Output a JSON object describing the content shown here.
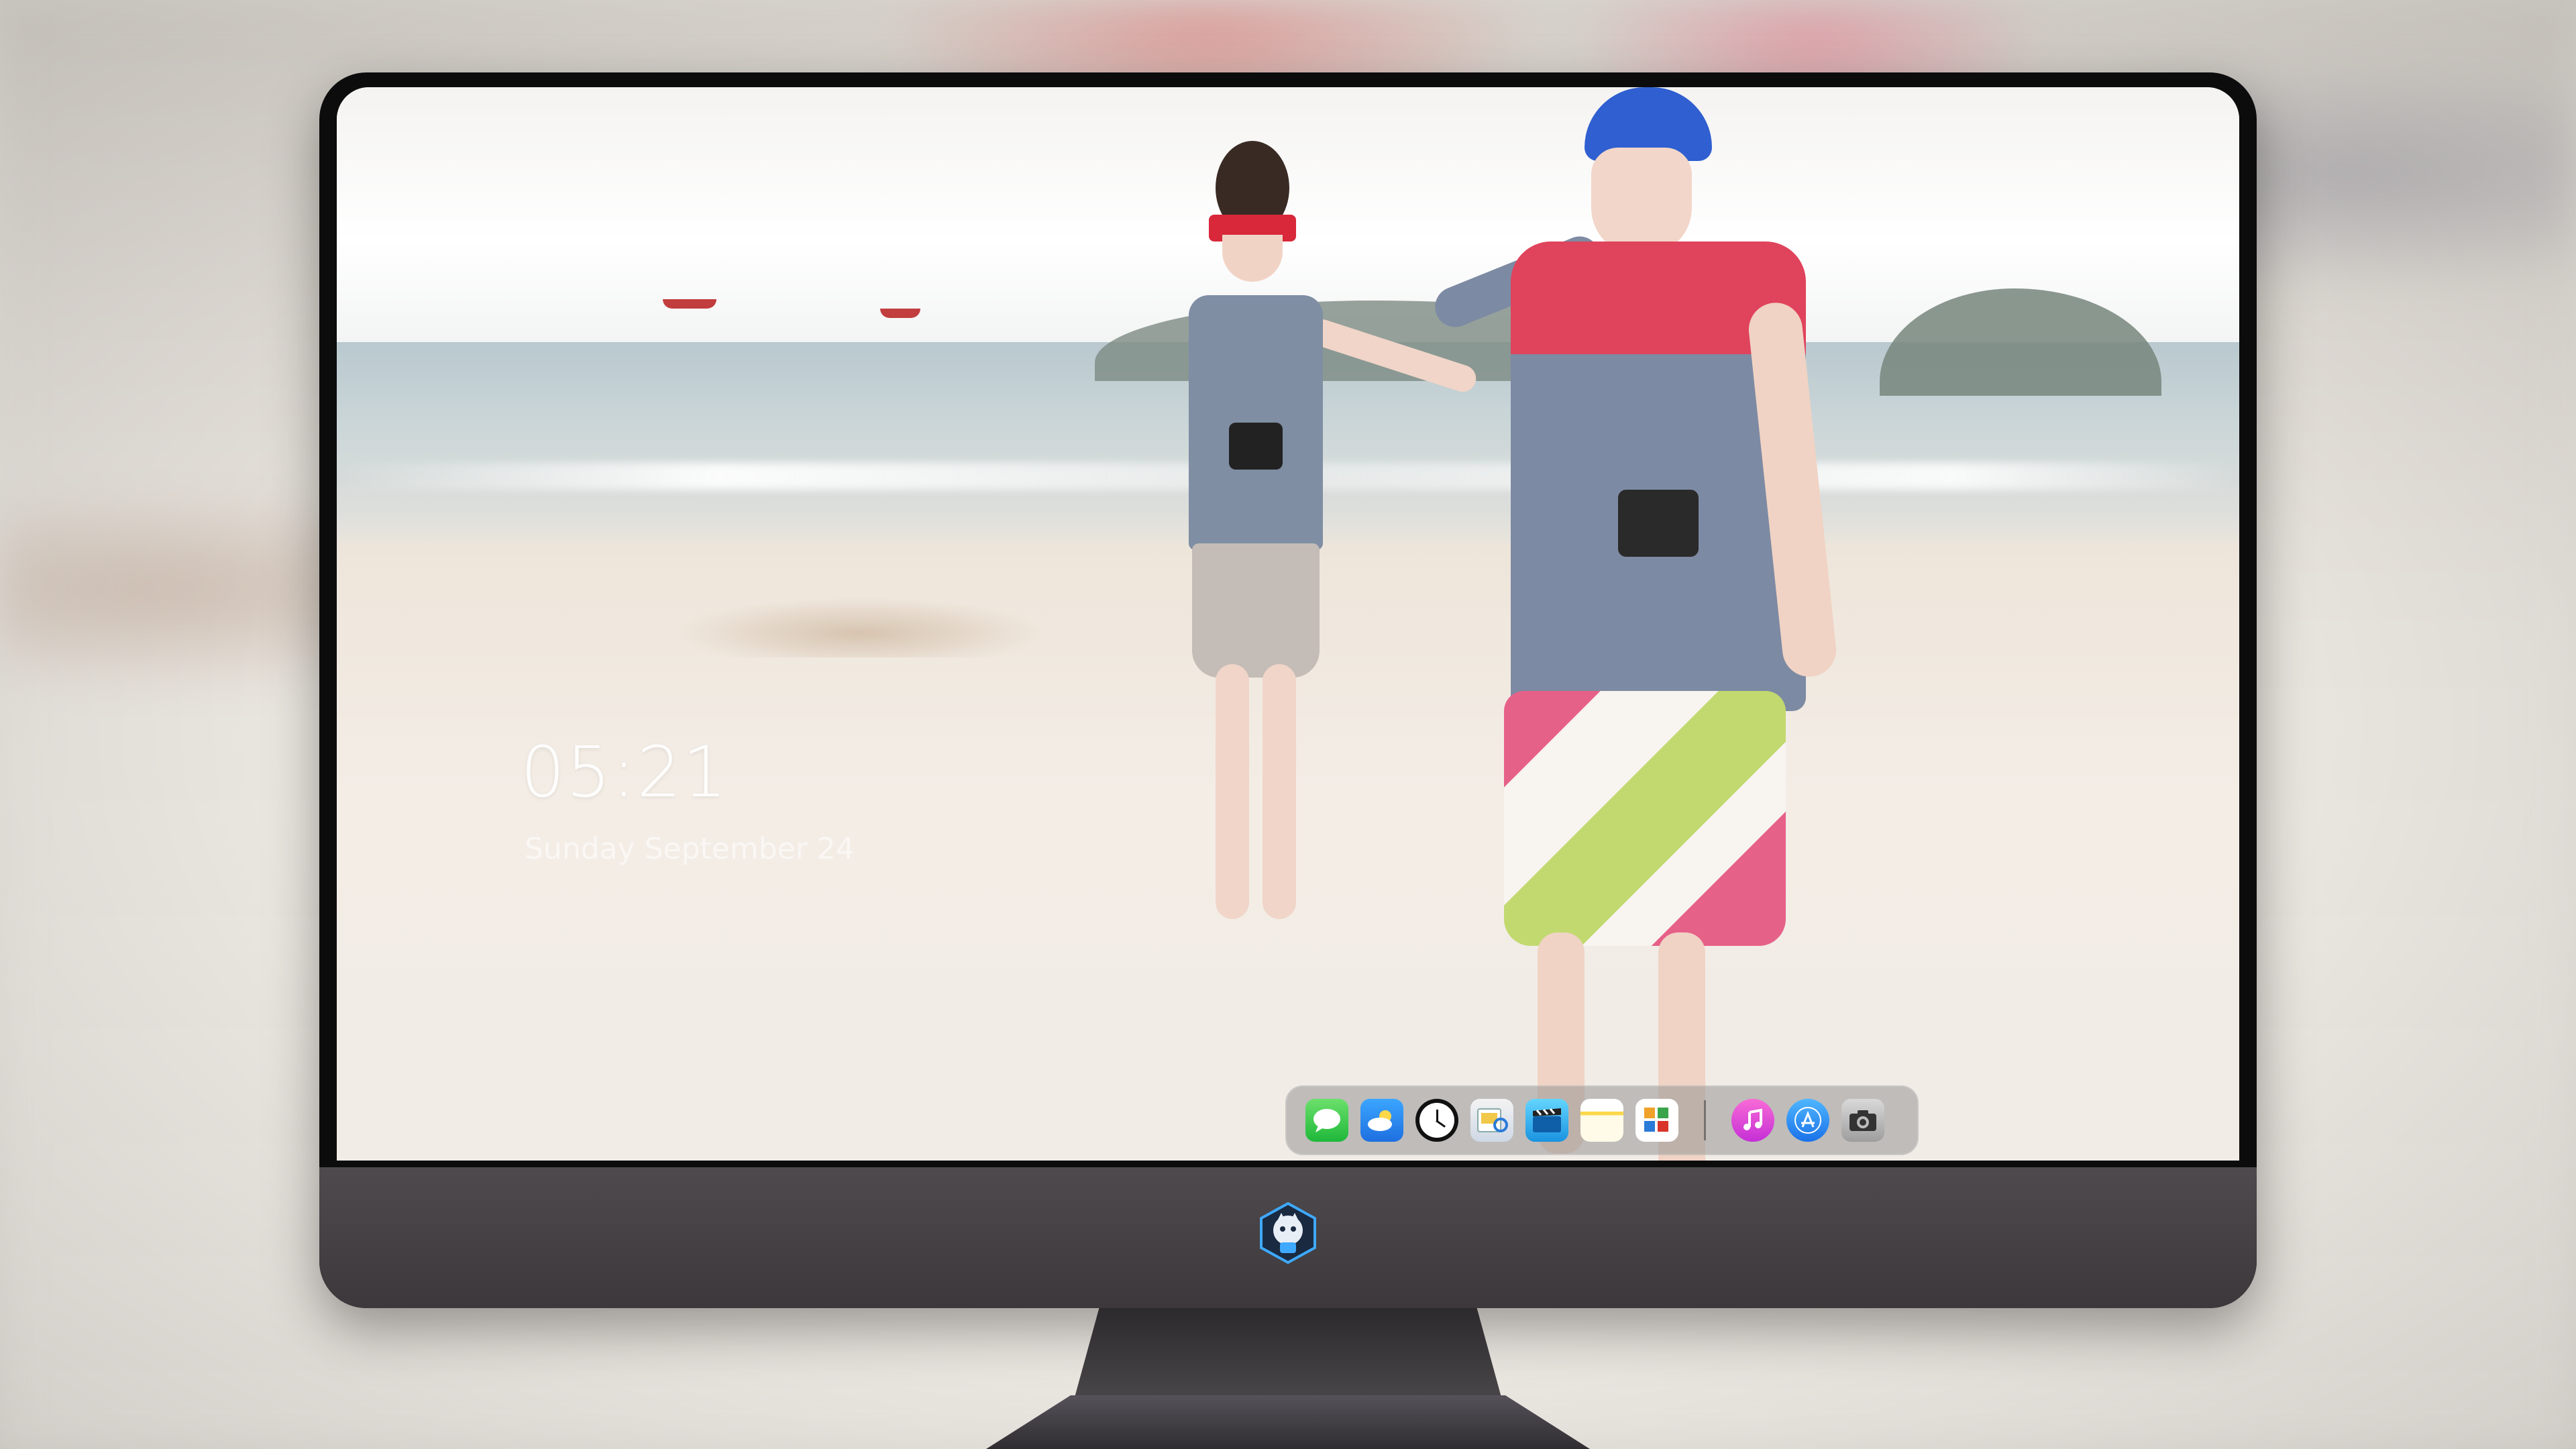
{
  "lock_screen": {
    "time": "05:21",
    "date": "Sunday September 24"
  },
  "dock": {
    "apps": [
      {
        "name": "Messages",
        "icon": "messages-icon"
      },
      {
        "name": "Weather",
        "icon": "weather-icon"
      },
      {
        "name": "Clock",
        "icon": "clock-icon"
      },
      {
        "name": "Preview",
        "icon": "preview-icon"
      },
      {
        "name": "Videos",
        "icon": "video-icon"
      },
      {
        "name": "Notes",
        "icon": "notes-icon"
      },
      {
        "name": "Photos",
        "icon": "photos-icon"
      },
      {
        "name": "Music",
        "icon": "music-icon"
      },
      {
        "name": "App Store",
        "icon": "app-store-icon"
      },
      {
        "name": "Camera",
        "icon": "camera-icon"
      }
    ]
  },
  "wallpaper": {
    "subject": "beach-couple-photo"
  },
  "colors": {
    "bezel": "#0c0c0d",
    "chin": "#4e4a4d",
    "dock_bg": "rgba(150,150,150,0.55)",
    "clock_text": "#ffffff"
  }
}
